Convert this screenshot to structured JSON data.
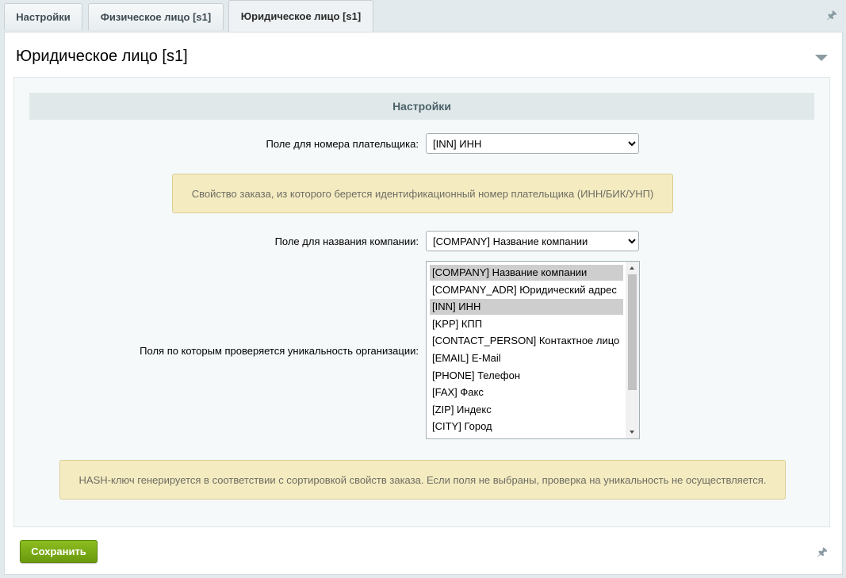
{
  "tabs": [
    {
      "label": "Настройки"
    },
    {
      "label": "Физическое лицо [s1]"
    },
    {
      "label": "Юридическое лицо [s1]"
    }
  ],
  "panel": {
    "title": "Юридическое лицо [s1]",
    "section_title": "Настройки"
  },
  "form": {
    "payer_field": {
      "label": "Поле для номера плательщика:",
      "selected": "[INN] ИНН"
    },
    "payer_note": "Свойство заказа, из которого берется идентификационный номер плательщика (ИНН/БИК/УНП)",
    "company_field": {
      "label": "Поле для названия компании:",
      "selected": "[COMPANY] Название компании"
    },
    "unique_fields": {
      "label": "Поля по которым проверяется уникальность организации:",
      "options": [
        {
          "text": "[COMPANY] Название компании",
          "selected": true
        },
        {
          "text": "[COMPANY_ADR] Юридический адрес",
          "selected": false
        },
        {
          "text": "[INN] ИНН",
          "selected": true
        },
        {
          "text": "[KPP] КПП",
          "selected": false
        },
        {
          "text": "[CONTACT_PERSON] Контактное лицо",
          "selected": false
        },
        {
          "text": "[EMAIL] E-Mail",
          "selected": false
        },
        {
          "text": "[PHONE] Телефон",
          "selected": false
        },
        {
          "text": "[FAX] Факс",
          "selected": false
        },
        {
          "text": "[ZIP] Индекс",
          "selected": false
        },
        {
          "text": "[CITY] Город",
          "selected": false
        }
      ]
    },
    "hash_note": "HASH-ключ генерируется в соответствии с сортировкой свойств заказа. Если поля не выбраны, проверка на уникальность не осуществляется."
  },
  "buttons": {
    "save": "Сохранить"
  },
  "icons": {
    "pin": "pin-icon",
    "collapse": "chevron-down-icon"
  },
  "colors": {
    "save_button": "#7aab16",
    "note_background": "#f4ebc1",
    "section_header": "#e0e8ea"
  }
}
